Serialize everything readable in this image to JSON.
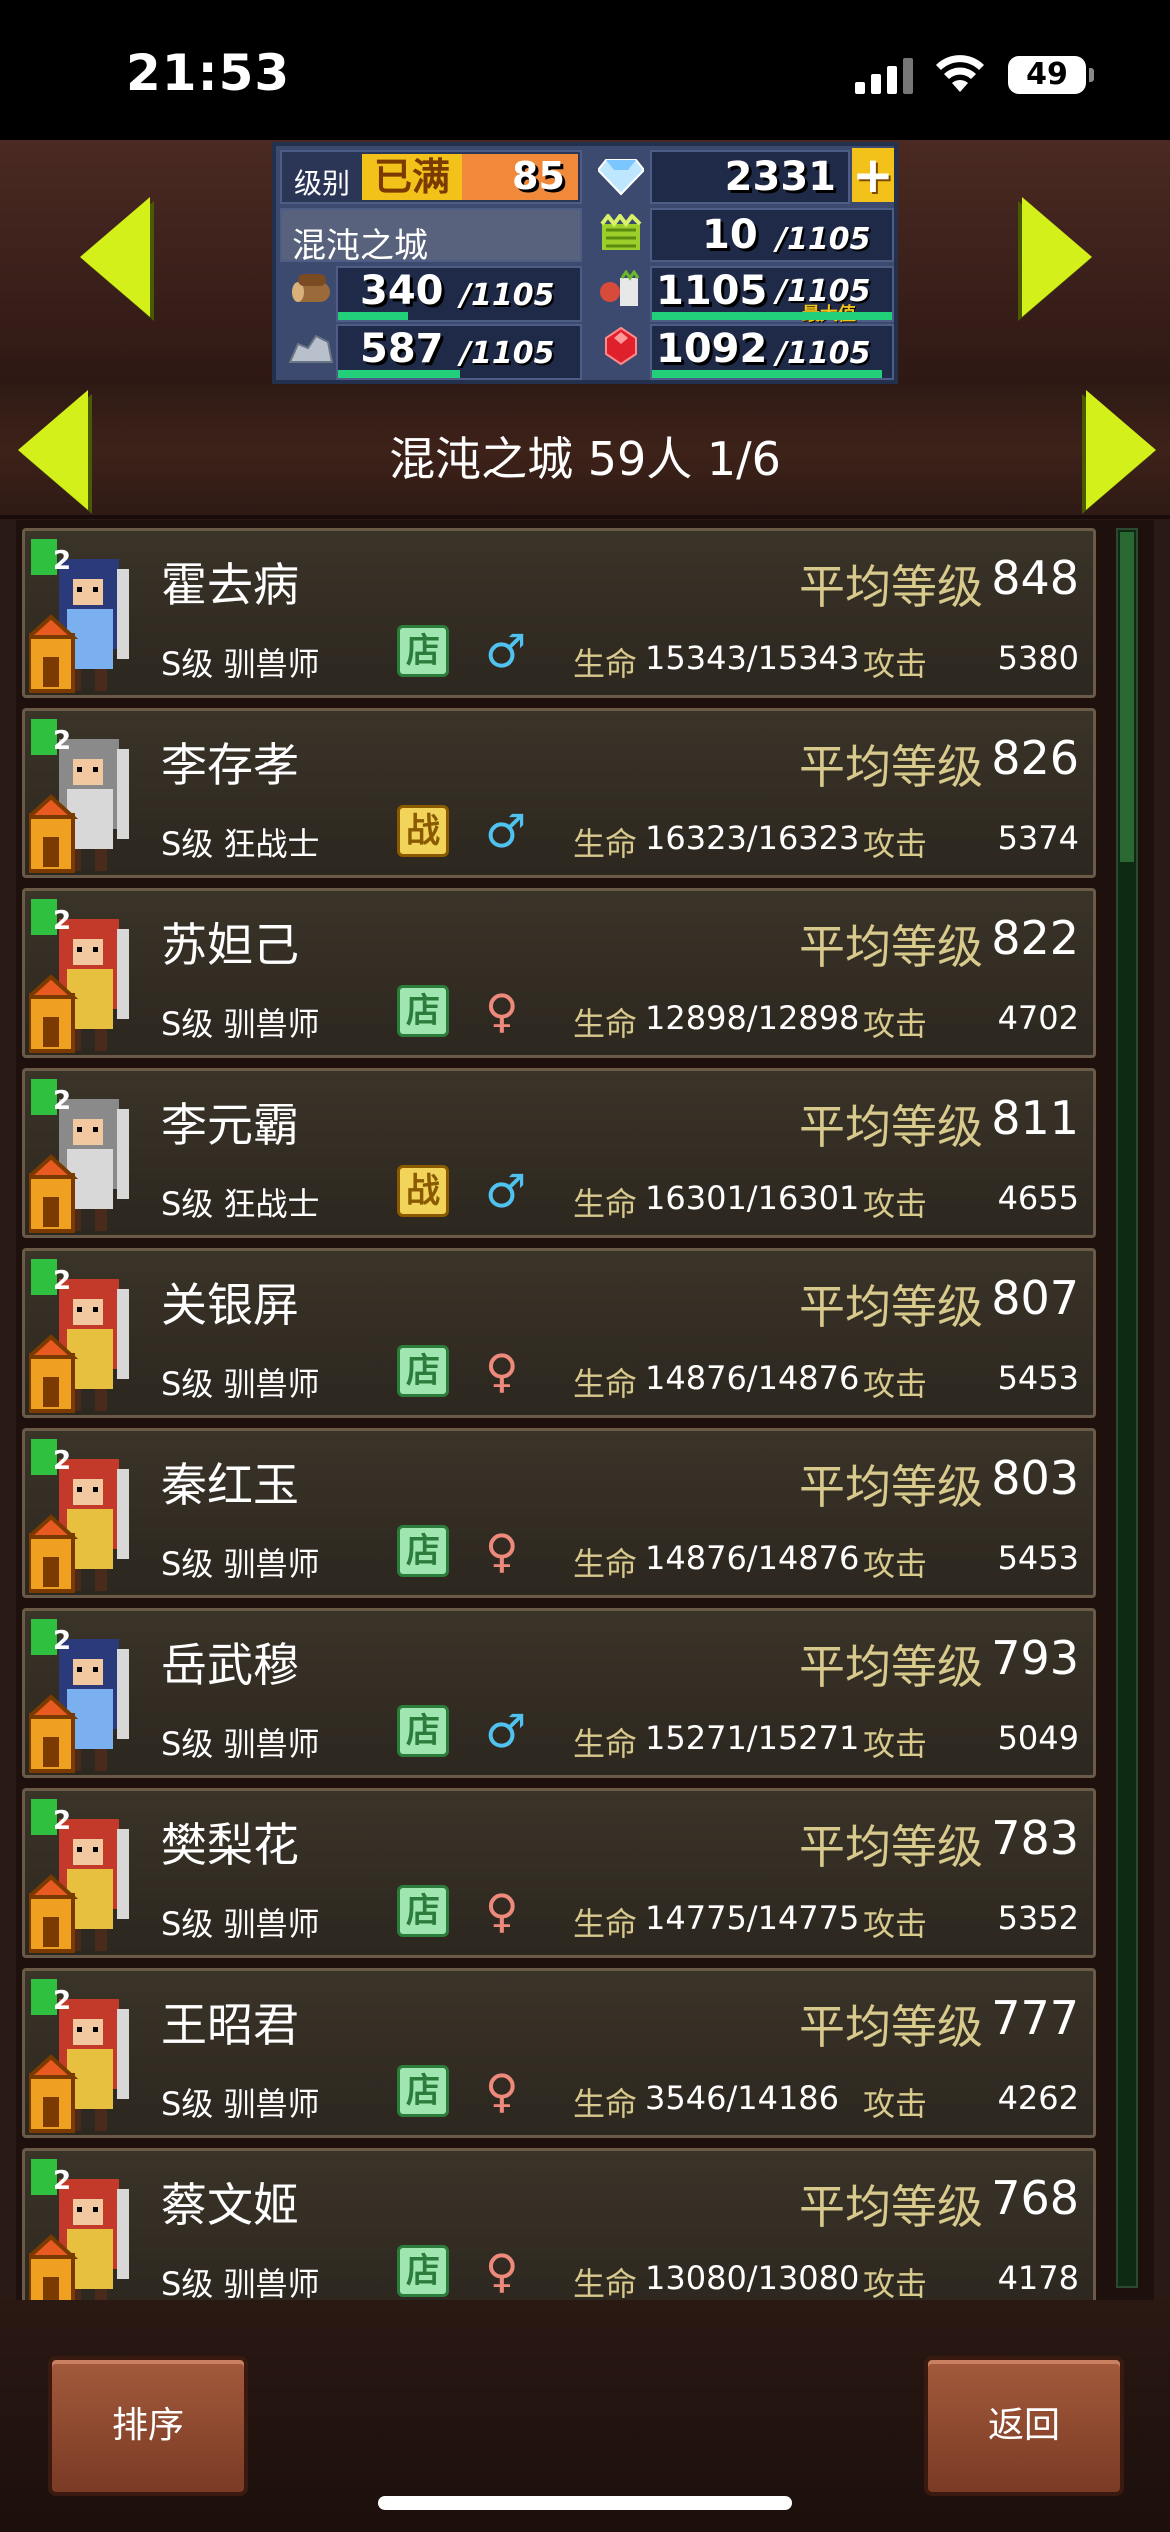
{
  "status": {
    "time": "21:53",
    "battery": "49"
  },
  "resources": {
    "level_label": "级别",
    "level_status": "已满",
    "level_value": "85",
    "gems": "2331",
    "castle_name": "混沌之城",
    "grass": "10",
    "grass_max": "/1105",
    "wood": "340",
    "wood_max": "/1105",
    "food": "1105",
    "food_max": "/1105",
    "food_note": "最大值",
    "stone": "587",
    "stone_max": "/1105",
    "ruby": "1092",
    "ruby_max": "/1105"
  },
  "title": "混沌之城  59人 1/6",
  "labels": {
    "avg_level": "平均等级",
    "hp": "生命",
    "atk": "攻击"
  },
  "characters": [
    {
      "name": "霍去病",
      "level": "848",
      "class": "S级 驯兽师",
      "badge": "店",
      "gender": "♂",
      "hp": "15343/15343",
      "atk": "5380"
    },
    {
      "name": "李存孝",
      "level": "826",
      "class": "S级 狂战士",
      "badge": "战",
      "gender": "♂",
      "hp": "16323/16323",
      "atk": "5374"
    },
    {
      "name": "苏妲己",
      "level": "822",
      "class": "S级 驯兽师",
      "badge": "店",
      "gender": "♀",
      "hp": "12898/12898",
      "atk": "4702"
    },
    {
      "name": "李元霸",
      "level": "811",
      "class": "S级 狂战士",
      "badge": "战",
      "gender": "♂",
      "hp": "16301/16301",
      "atk": "4655"
    },
    {
      "name": "关银屏",
      "level": "807",
      "class": "S级 驯兽师",
      "badge": "店",
      "gender": "♀",
      "hp": "14876/14876",
      "atk": "5453"
    },
    {
      "name": "秦红玉",
      "level": "803",
      "class": "S级 驯兽师",
      "badge": "店",
      "gender": "♀",
      "hp": "14876/14876",
      "atk": "5453"
    },
    {
      "name": "岳武穆",
      "level": "793",
      "class": "S级 驯兽师",
      "badge": "店",
      "gender": "♂",
      "hp": "15271/15271",
      "atk": "5049"
    },
    {
      "name": "樊梨花",
      "level": "783",
      "class": "S级 驯兽师",
      "badge": "店",
      "gender": "♀",
      "hp": "14775/14775",
      "atk": "5352"
    },
    {
      "name": "王昭君",
      "level": "777",
      "class": "S级 驯兽师",
      "badge": "店",
      "gender": "♀",
      "hp": "3546/14186",
      "atk": "4262"
    },
    {
      "name": "蔡文姬",
      "level": "768",
      "class": "S级 驯兽师",
      "badge": "店",
      "gender": "♀",
      "hp": "13080/13080",
      "atk": "4178"
    }
  ],
  "buttons": {
    "sort": "排序",
    "back": "返回"
  }
}
